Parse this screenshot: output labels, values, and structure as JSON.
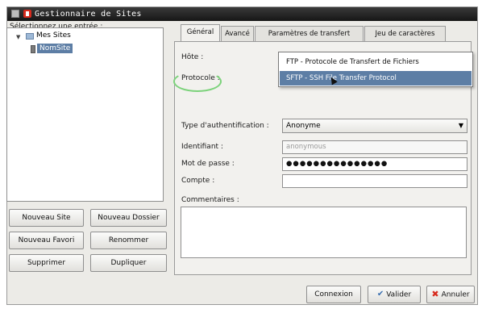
{
  "window": {
    "title": "Gestionnaire de Sites"
  },
  "left": {
    "select_label": "Sélectionnez une entrée :",
    "tree": {
      "root": "Mes Sites",
      "site": "NomSite"
    },
    "buttons": {
      "new_site": "Nouveau Site",
      "new_folder": "Nouveau Dossier",
      "new_bookmark": "Nouveau Favori",
      "rename": "Renommer",
      "delete": "Supprimer",
      "duplicate": "Dupliquer"
    }
  },
  "tabs": [
    "Général",
    "Avancé",
    "Paramètres de transfert",
    "Jeu de caractères"
  ],
  "general": {
    "host_label": "Hôte :",
    "protocol_label": "Protocole :",
    "protocol_options": [
      "FTP - Protocole de Transfert de Fichiers",
      "SFTP - SSH File Transfer Protocol"
    ],
    "protocol_highlighted": "SFTP - SSH File Transfer Protocol",
    "auth_label": "Type d'authentification :",
    "auth_value": "Anonyme",
    "user_label": "Identifiant :",
    "user_value": "anonymous",
    "password_label": "Mot de passe :",
    "password_value": "●●●●●●●●●●●●●●●",
    "account_label": "Compte :",
    "account_value": "",
    "comments_label": "Commentaires :"
  },
  "footer": {
    "connect": "Connexion",
    "validate": "Valider",
    "cancel": "Annuler"
  },
  "colors": {
    "selection": "#5d7ea5",
    "highlight_ellipse": "#7bd27a",
    "cancel_icon": "#d72a1d"
  }
}
